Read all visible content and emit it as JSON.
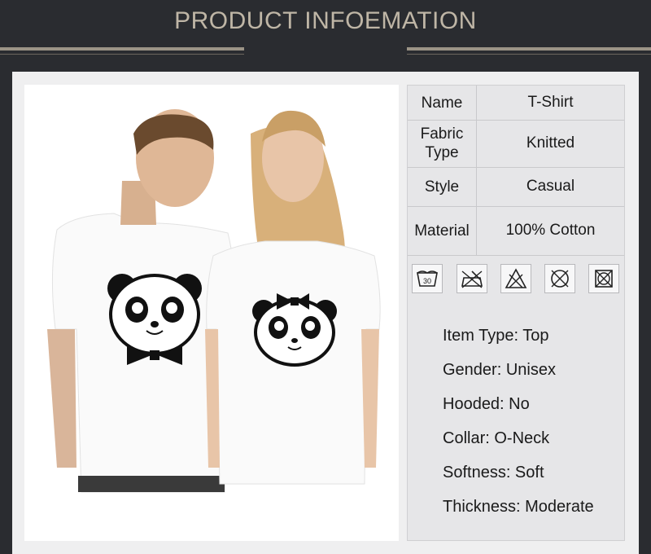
{
  "header": {
    "title": "PRODUCT INFOEMATION"
  },
  "table": [
    {
      "key": "Name",
      "value": "T-Shirt"
    },
    {
      "key": "Fabric Type",
      "value": "Knitted"
    },
    {
      "key": "Style",
      "value": "Casual"
    },
    {
      "key": "Material",
      "value": "100% Cotton"
    }
  ],
  "care_icons": [
    {
      "name": "wash-30-icon",
      "label": "30"
    },
    {
      "name": "no-bleach-icon"
    },
    {
      "name": "no-chlorine-icon"
    },
    {
      "name": "no-dry-clean-icon"
    },
    {
      "name": "no-tumble-dry-icon"
    }
  ],
  "specs": [
    "Item Type: Top",
    "Gender: Unisex",
    "Hooded: No",
    "Collar: O-Neck",
    "Softness: Soft",
    "Thickness: Moderate"
  ],
  "colors": {
    "background": "#2a2c30",
    "title": "#bfb6a6",
    "panel": "#efeff0"
  }
}
